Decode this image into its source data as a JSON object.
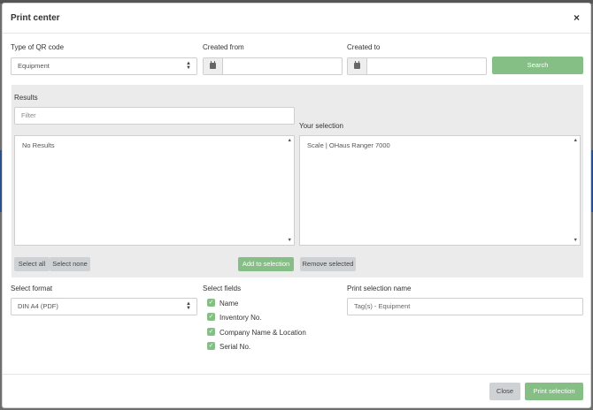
{
  "modal": {
    "title": "Print center",
    "close_icon": "close-icon"
  },
  "filters": {
    "qr_type_label": "Type of QR code",
    "qr_type_value": "Equipment",
    "created_from_label": "Created from",
    "created_from_value": "",
    "created_to_label": "Created to",
    "created_to_value": "",
    "search_label": "Search"
  },
  "results": {
    "label": "Results",
    "filter_placeholder": "Filter",
    "empty_text": "No Results",
    "select_all_label": "Select all",
    "select_none_label": "Select none",
    "add_label": "Add to selection"
  },
  "selection": {
    "label": "Your selection",
    "items": [
      "Scale | OHaus Ranger 7000"
    ],
    "remove_label": "Remove selected"
  },
  "format": {
    "label": "Select format",
    "value": "DIN A4 (PDF)"
  },
  "fields": {
    "label": "Select fields",
    "items": [
      {
        "label": "Name",
        "checked": true
      },
      {
        "label": "Inventory No.",
        "checked": true
      },
      {
        "label": "Company Name & Location",
        "checked": true
      },
      {
        "label": "Serial No.",
        "checked": true
      }
    ]
  },
  "print_name": {
    "label": "Print selection name",
    "value": "Tag(s) - Equipment"
  },
  "footer": {
    "close_label": "Close",
    "print_label": "Print selection"
  },
  "colors": {
    "accent_green": "#85bf85",
    "neutral_button": "#cfd2d4",
    "panel_bg": "#ebebeb"
  }
}
